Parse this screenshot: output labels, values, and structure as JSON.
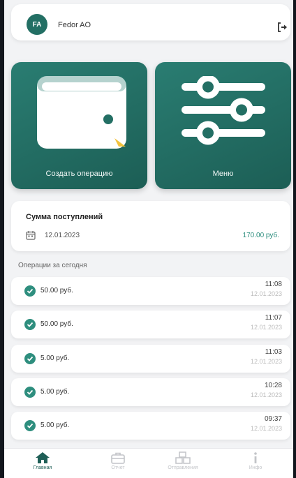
{
  "header": {
    "avatar_initials": "FA",
    "user_name": "Fedor AO",
    "logout_icon": "logout-icon"
  },
  "tiles": {
    "create_label": "Создать операцию",
    "menu_label": "Меню",
    "create_icon": "wallet-icon",
    "menu_icon": "sliders-icon"
  },
  "summary": {
    "title": "Сумма поступлений",
    "date": "12.01.2023",
    "amount": "170.00 руб."
  },
  "operations_title": "Операции за сегодня",
  "operations": [
    {
      "amount": "50.00 руб.",
      "time": "11:08",
      "date": "12.01.2023"
    },
    {
      "amount": "50.00 руб.",
      "time": "11:07",
      "date": "12.01.2023"
    },
    {
      "amount": "5.00 руб.",
      "time": "11:03",
      "date": "12.01.2023"
    },
    {
      "amount": "5.00 руб.",
      "time": "10:28",
      "date": "12.01.2023"
    },
    {
      "amount": "5.00 руб.",
      "time": "09:37",
      "date": "12.01.2023"
    }
  ],
  "tabbar": [
    {
      "label": "Главная",
      "icon": "home-icon",
      "active": true
    },
    {
      "label": "Отчет",
      "icon": "briefcase-icon",
      "active": false
    },
    {
      "label": "Отправления",
      "icon": "boxes-icon",
      "active": false
    },
    {
      "label": "Инфо",
      "icon": "info-icon",
      "active": false
    }
  ],
  "colors": {
    "accent": "#236f64",
    "accent_light": "#2a8c7c",
    "background": "#f2f3f5"
  }
}
